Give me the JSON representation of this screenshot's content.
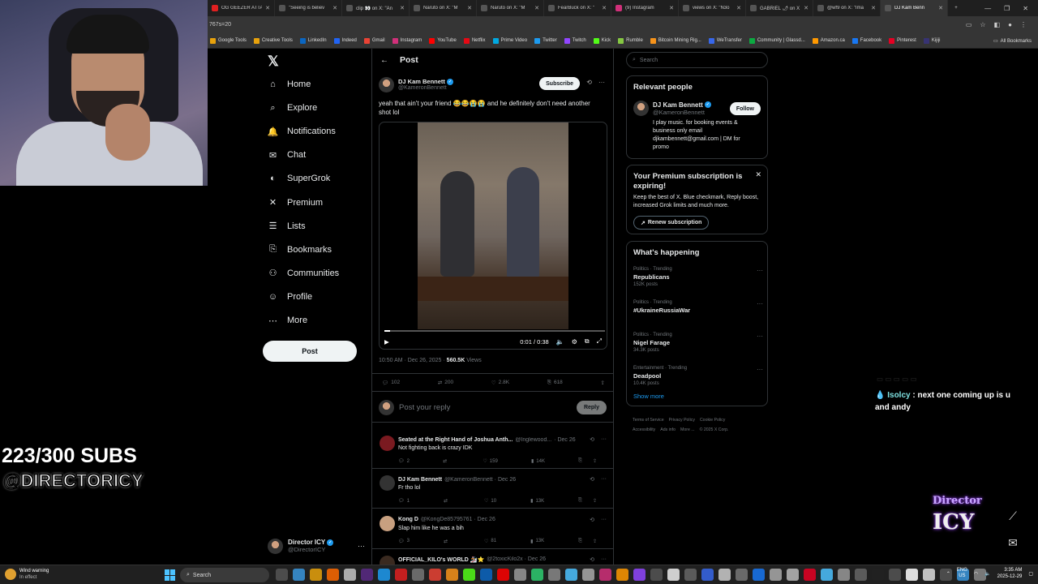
{
  "browser": {
    "tabs": [
      {
        "label": "OG GEEZER ATTA",
        "color": "#e02020"
      },
      {
        "label": "\"Seeing is believ",
        "color": "#555"
      },
      {
        "label": "clip 👀 on X: \"An",
        "color": "#555"
      },
      {
        "label": "Naruto on X: \"M",
        "color": "#555"
      },
      {
        "label": "Naruto on X: \"M",
        "color": "#555"
      },
      {
        "label": "FearBuck on X: \"",
        "color": "#555"
      },
      {
        "label": "(9) Instagram",
        "color": "#d1307a"
      },
      {
        "label": "views on X: \"N3o",
        "color": "#555"
      },
      {
        "label": "GABRIEL 🌶 on X",
        "color": "#555"
      },
      {
        "label": "@wf9 on X: \"Ima",
        "color": "#555"
      },
      {
        "label": "DJ Kam Benn",
        "color": "#555",
        "active": true
      }
    ],
    "new_tab": "+",
    "address_tail": "767s=20",
    "bookmarks": [
      {
        "label": "Google Tools",
        "color": "#e8a20c"
      },
      {
        "label": "Creative Tools",
        "color": "#e8a20c"
      },
      {
        "label": "LinkedIn",
        "color": "#0a66c2"
      },
      {
        "label": "Indeed",
        "color": "#2164f3"
      },
      {
        "label": "Gmail",
        "color": "#ea4335"
      },
      {
        "label": "Instagram",
        "color": "#d1307a"
      },
      {
        "label": "YouTube",
        "color": "#ff0000"
      },
      {
        "label": "Netflix",
        "color": "#e50914"
      },
      {
        "label": "Prime Video",
        "color": "#00a8e1"
      },
      {
        "label": "Twitter",
        "color": "#1d9bf0"
      },
      {
        "label": "Twitch",
        "color": "#9146ff"
      },
      {
        "label": "Kick",
        "color": "#53fc18"
      },
      {
        "label": "Rumble",
        "color": "#85c742"
      },
      {
        "label": "Bitcoin Mining Rig...",
        "color": "#f7931a"
      },
      {
        "label": "WeTransfer",
        "color": "#3767ea"
      },
      {
        "label": "Community | Glassd...",
        "color": "#0caa41"
      },
      {
        "label": "Amazon.ca",
        "color": "#ff9900"
      },
      {
        "label": "Facebook",
        "color": "#1877f2"
      },
      {
        "label": "Pinterest",
        "color": "#e60023"
      },
      {
        "label": "Kijiji",
        "color": "#373373"
      }
    ],
    "all_bookmarks": "All Bookmarks"
  },
  "nav": {
    "items": [
      {
        "label": "Home",
        "icon": "home-icon",
        "glyph": "⌂"
      },
      {
        "label": "Explore",
        "icon": "search-icon",
        "glyph": "⌕"
      },
      {
        "label": "Notifications",
        "icon": "bell-icon",
        "glyph": "🔔"
      },
      {
        "label": "Chat",
        "icon": "mail-icon",
        "glyph": "✉"
      },
      {
        "label": "SuperGrok",
        "icon": "grok-icon",
        "glyph": "◐"
      },
      {
        "label": "Premium",
        "icon": "x-icon",
        "glyph": "✕"
      },
      {
        "label": "Lists",
        "icon": "list-icon",
        "glyph": "☰"
      },
      {
        "label": "Bookmarks",
        "icon": "bookmark-icon",
        "glyph": "⎘"
      },
      {
        "label": "Communities",
        "icon": "people-icon",
        "glyph": "⚇"
      },
      {
        "label": "Profile",
        "icon": "person-icon",
        "glyph": "☺"
      },
      {
        "label": "More",
        "icon": "more-circle-icon",
        "glyph": "⋯"
      }
    ],
    "post_button": "Post",
    "account": {
      "name": "Director ICY",
      "handle": "@DirectorICY"
    }
  },
  "post": {
    "header_title": "Post",
    "author_name": "DJ Kam Bennett",
    "author_handle": "@KameronBennett",
    "subscribe": "Subscribe",
    "text": "yeah that ain't your friend 😂😂😭😭 and he definitely don't need another shot lol",
    "video": {
      "time": "0:01 / 0:38",
      "progress": 0.026
    },
    "timestamp": "10:50 AM · Dec 26, 2025 · ",
    "views_count": "560.5K",
    "views_label": " Views",
    "stats": {
      "replies": "102",
      "reposts": "200",
      "likes": "2.8K",
      "bookmarks": "618"
    },
    "reply_placeholder": "Post your reply",
    "reply_button": "Reply"
  },
  "replies": [
    {
      "name": "Seated at the Right Hand of Joshua Anth...",
      "handle": "@Inglewood...",
      "date": "· Dec 26",
      "text": "Not fighting back is crazy IDK",
      "stats": [
        "2",
        "",
        "159",
        "14K"
      ],
      "avatar": "#7a1a20"
    },
    {
      "name": "DJ Kam Bennett",
      "handle": "@KameronBennett · Dec 26",
      "date": "",
      "text": "Fr tho lol",
      "stats": [
        "1",
        "",
        "10",
        "13K"
      ],
      "avatar": "#333"
    },
    {
      "name": "Kong D",
      "handle": "@KongDe85795761 · Dec 26",
      "date": "",
      "text": "Slap him like he was a bih",
      "stats": [
        "3",
        "",
        "81",
        "13K"
      ],
      "avatar": "#c8a080"
    },
    {
      "name": "OFFICIAL_KILO's WORLD 🏂⭐",
      "handle": "@2toxicKilo2x · Dec 26",
      "date": "",
      "text": "",
      "stats": [
        "",
        "",
        "",
        ""
      ],
      "avatar": "#3a2a20"
    }
  ],
  "right": {
    "search_placeholder": "Search",
    "relevant_title": "Relevant people",
    "person_name": "DJ Kam Bennett",
    "person_handle": "@KameronBennett",
    "follow": "Follow",
    "bio": "I play music. for booking events & business only email djkambennett@gmail.com | DM for promo",
    "premium_title": "Your Premium subscription is expiring!",
    "premium_text": "Keep the best of X. Blue checkmark, Reply boost, increased Grok limits and much more.",
    "renew": "Renew subscription",
    "happening_title": "What's happening",
    "trends": [
      {
        "context": "Politics · Trending",
        "name": "Republicans",
        "posts": "152K posts"
      },
      {
        "context": "Politics · Trending",
        "name": "#UkraineRussiaWar",
        "posts": ""
      },
      {
        "context": "Politics · Trending",
        "name": "Nigel Farage",
        "posts": "34.3K posts"
      },
      {
        "context": "Entertainment · Trending",
        "name": "Deadpool",
        "posts": "10.4K posts"
      }
    ],
    "show_more": "Show more",
    "footer": [
      "Terms of Service",
      "Privacy Policy",
      "Cookie Policy",
      "Accessibility",
      "Ads info",
      "More ...",
      "© 2025 X Corp."
    ]
  },
  "overlay": {
    "subs": "223/300 SUBS",
    "handle": "@DIRECTORICY",
    "chat_user": "Isolcy",
    "chat_text": " : next one coming up is u and andy",
    "logo_top": "Director",
    "logo_bottom": "ICY"
  },
  "taskbar": {
    "weather_title": "Wind warning",
    "weather_sub": "In effect",
    "search": "Search",
    "lang_top": "ENG",
    "lang_bottom": "US",
    "time": "3:35 AM",
    "date": "2025-12-29"
  }
}
